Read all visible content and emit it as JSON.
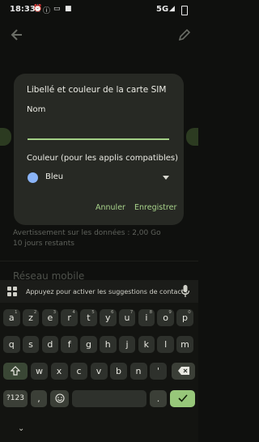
{
  "status_bar": {
    "time": "18:33",
    "network": "5G"
  },
  "background_page": {
    "usage_warning": "Avertissement sur les données : 2,00 Go",
    "days_left": "10 jours restants",
    "section_title": "Réseau mobile"
  },
  "dialog": {
    "title": "Libellé et couleur de la carte SIM",
    "name_label": "Nom",
    "name_value": "",
    "color_label": "Couleur (pour les applis compatibles)",
    "color_value": "Bleu",
    "color_swatch": "#8ab4f8",
    "cancel_label": "Annuler",
    "save_label": "Enregistrer"
  },
  "keyboard": {
    "suggestion_text": "Appuyez pour activer les suggestions de contacts.",
    "row1": [
      {
        "k": "a",
        "s": "1"
      },
      {
        "k": "z",
        "s": "2"
      },
      {
        "k": "e",
        "s": "3"
      },
      {
        "k": "r",
        "s": "4"
      },
      {
        "k": "t",
        "s": "5"
      },
      {
        "k": "y",
        "s": "6"
      },
      {
        "k": "u",
        "s": "7"
      },
      {
        "k": "i",
        "s": "8"
      },
      {
        "k": "o",
        "s": "9"
      },
      {
        "k": "p",
        "s": "0"
      }
    ],
    "row2": [
      "q",
      "s",
      "d",
      "f",
      "g",
      "h",
      "j",
      "k",
      "l",
      "m"
    ],
    "row3": [
      "w",
      "x",
      "c",
      "v",
      "b",
      "n",
      "'"
    ],
    "symbols_label": "?123",
    "comma_label": ",",
    "period_label": "."
  },
  "colors": {
    "accent": "#a8d38b",
    "dialog_bg": "#272924",
    "enter_key": "#97c77a"
  }
}
